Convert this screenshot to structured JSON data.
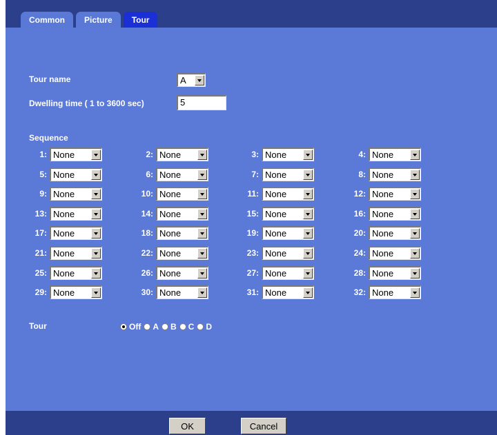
{
  "tabs": [
    {
      "label": "Common",
      "active": false
    },
    {
      "label": "Picture",
      "active": false
    },
    {
      "label": "Tour",
      "active": true
    }
  ],
  "form": {
    "tour_name_label": "Tour name",
    "tour_name_value": "A",
    "dwelling_label": "Dwelling time ( 1 to 3600 sec)",
    "dwelling_value": "5",
    "sequence_label": "Sequence"
  },
  "sequence": [
    {
      "n": "1:",
      "v": "None"
    },
    {
      "n": "2:",
      "v": "None"
    },
    {
      "n": "3:",
      "v": "None"
    },
    {
      "n": "4:",
      "v": "None"
    },
    {
      "n": "5:",
      "v": "None"
    },
    {
      "n": "6:",
      "v": "None"
    },
    {
      "n": "7:",
      "v": "None"
    },
    {
      "n": "8:",
      "v": "None"
    },
    {
      "n": "9:",
      "v": "None"
    },
    {
      "n": "10:",
      "v": "None"
    },
    {
      "n": "11:",
      "v": "None"
    },
    {
      "n": "12:",
      "v": "None"
    },
    {
      "n": "13:",
      "v": "None"
    },
    {
      "n": "14:",
      "v": "None"
    },
    {
      "n": "15:",
      "v": "None"
    },
    {
      "n": "16:",
      "v": "None"
    },
    {
      "n": "17:",
      "v": "None"
    },
    {
      "n": "18:",
      "v": "None"
    },
    {
      "n": "19:",
      "v": "None"
    },
    {
      "n": "20:",
      "v": "None"
    },
    {
      "n": "21:",
      "v": "None"
    },
    {
      "n": "22:",
      "v": "None"
    },
    {
      "n": "23:",
      "v": "None"
    },
    {
      "n": "24:",
      "v": "None"
    },
    {
      "n": "25:",
      "v": "None"
    },
    {
      "n": "26:",
      "v": "None"
    },
    {
      "n": "27:",
      "v": "None"
    },
    {
      "n": "28:",
      "v": "None"
    },
    {
      "n": "29:",
      "v": "None"
    },
    {
      "n": "30:",
      "v": "None"
    },
    {
      "n": "31:",
      "v": "None"
    },
    {
      "n": "32:",
      "v": "None"
    }
  ],
  "tour": {
    "label": "Tour",
    "options": [
      {
        "label": "Off",
        "checked": true
      },
      {
        "label": "A",
        "checked": false
      },
      {
        "label": "B",
        "checked": false
      },
      {
        "label": "C",
        "checked": false
      },
      {
        "label": "D",
        "checked": false
      }
    ]
  },
  "buttons": {
    "ok": "OK",
    "cancel": "Cancel"
  }
}
